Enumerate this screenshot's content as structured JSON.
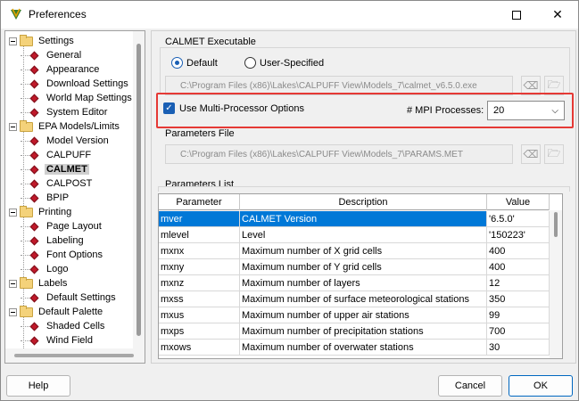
{
  "window": {
    "title": "Preferences"
  },
  "tree": {
    "items": [
      {
        "label": "Settings",
        "kind": "folder"
      },
      {
        "label": "General",
        "kind": "leaf"
      },
      {
        "label": "Appearance",
        "kind": "leaf"
      },
      {
        "label": "Download Settings",
        "kind": "leaf"
      },
      {
        "label": "World Map Settings",
        "kind": "leaf"
      },
      {
        "label": "System Editor",
        "kind": "leaf"
      },
      {
        "label": "EPA Models/Limits",
        "kind": "folder"
      },
      {
        "label": "Model Version",
        "kind": "leaf"
      },
      {
        "label": "CALPUFF",
        "kind": "leaf"
      },
      {
        "label": "CALMET",
        "kind": "leaf",
        "selected": true
      },
      {
        "label": "CALPOST",
        "kind": "leaf"
      },
      {
        "label": "BPIP",
        "kind": "leaf"
      },
      {
        "label": "Printing",
        "kind": "folder"
      },
      {
        "label": "Page Layout",
        "kind": "leaf"
      },
      {
        "label": "Labeling",
        "kind": "leaf"
      },
      {
        "label": "Font Options",
        "kind": "leaf"
      },
      {
        "label": "Logo",
        "kind": "leaf"
      },
      {
        "label": "Labels",
        "kind": "folder"
      },
      {
        "label": "Default Settings",
        "kind": "leaf"
      },
      {
        "label": "Default Palette",
        "kind": "folder"
      },
      {
        "label": "Shaded Cells",
        "kind": "leaf"
      },
      {
        "label": "Wind Field",
        "kind": "leaf"
      }
    ]
  },
  "executable": {
    "group_label": "CALMET Executable",
    "radio_default": "Default",
    "radio_user": "User-Specified",
    "selected": "Default",
    "path": "C:\\Program Files (x86)\\Lakes\\CALPUFF View\\Models_7\\calmet_v6.5.0.exe"
  },
  "mpi": {
    "checkbox_label": "Use Multi-Processor Options",
    "checked": true,
    "processes_label": "# MPI Processes:",
    "processes_value": "20"
  },
  "params_file": {
    "group_label": "Parameters File",
    "path": "C:\\Program Files (x86)\\Lakes\\CALPUFF View\\Models_7\\PARAMS.MET"
  },
  "params_list": {
    "group_label": "Parameters List",
    "columns": [
      "Parameter",
      "Description",
      "Value"
    ],
    "rows": [
      [
        "mver",
        "CALMET Version",
        "'6.5.0'"
      ],
      [
        "mlevel",
        "Level",
        "'150223'"
      ],
      [
        "mxnx",
        "Maximum number of X grid cells",
        "400"
      ],
      [
        "mxny",
        "Maximum number of Y grid cells",
        "400"
      ],
      [
        "mxnz",
        "Maximum number of layers",
        "12"
      ],
      [
        "mxss",
        "Maximum number of surface meteorological stations",
        "350"
      ],
      [
        "mxus",
        "Maximum number of upper air stations",
        "99"
      ],
      [
        "mxps",
        "Maximum number of precipitation stations",
        "700"
      ],
      [
        "mxows",
        "Maximum number of overwater stations",
        "30"
      ]
    ]
  },
  "buttons": {
    "help": "Help",
    "cancel": "Cancel",
    "ok": "OK"
  },
  "colors": {
    "accent": "#0078d7",
    "highlight": "#e53935",
    "leaf_icon": "#c0192a"
  }
}
